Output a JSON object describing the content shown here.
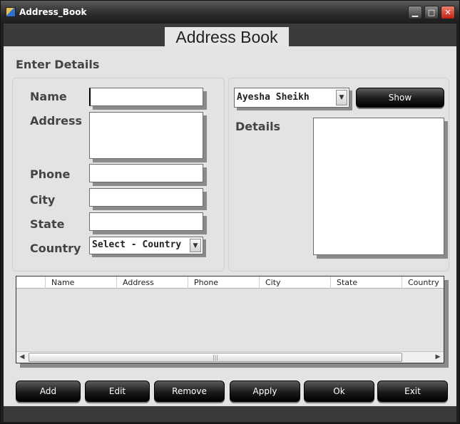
{
  "window": {
    "title": "Address_Book",
    "minimize_glyph": "▁",
    "maximize_glyph": "□",
    "close_glyph": "✕",
    "icon": "app-icon"
  },
  "header": {
    "title": "Address Book"
  },
  "entry_section": {
    "label": "Enter Details",
    "fields": {
      "name": {
        "label": "Name",
        "value": ""
      },
      "address": {
        "label": "Address",
        "value": ""
      },
      "phone": {
        "label": "Phone",
        "value": ""
      },
      "city": {
        "label": "City",
        "value": ""
      },
      "state": {
        "label": "State",
        "value": ""
      },
      "country": {
        "label": "Country",
        "selected": "Select - Country"
      }
    }
  },
  "lookup_section": {
    "contact_selected": "Ayesha Sheikh",
    "show_label": "Show",
    "details_label": "Details",
    "details_value": ""
  },
  "grid": {
    "columns": [
      "Name",
      "Address",
      "Phone",
      "City",
      "State",
      "Country"
    ],
    "rows": [],
    "scroll_left_glyph": "◀",
    "scroll_right_glyph": "▶",
    "thumb_grip": "|||"
  },
  "actions": {
    "add": "Add",
    "edit": "Edit",
    "remove": "Remove",
    "apply": "Apply",
    "ok": "Ok",
    "exit": "Exit"
  },
  "dropdown_arrow_glyph": "▼",
  "colors": {
    "chrome_dark": "#1e1e1e",
    "client_bg": "#e3e3e3",
    "button_dark": "#000000",
    "close_red": "#c02010"
  }
}
